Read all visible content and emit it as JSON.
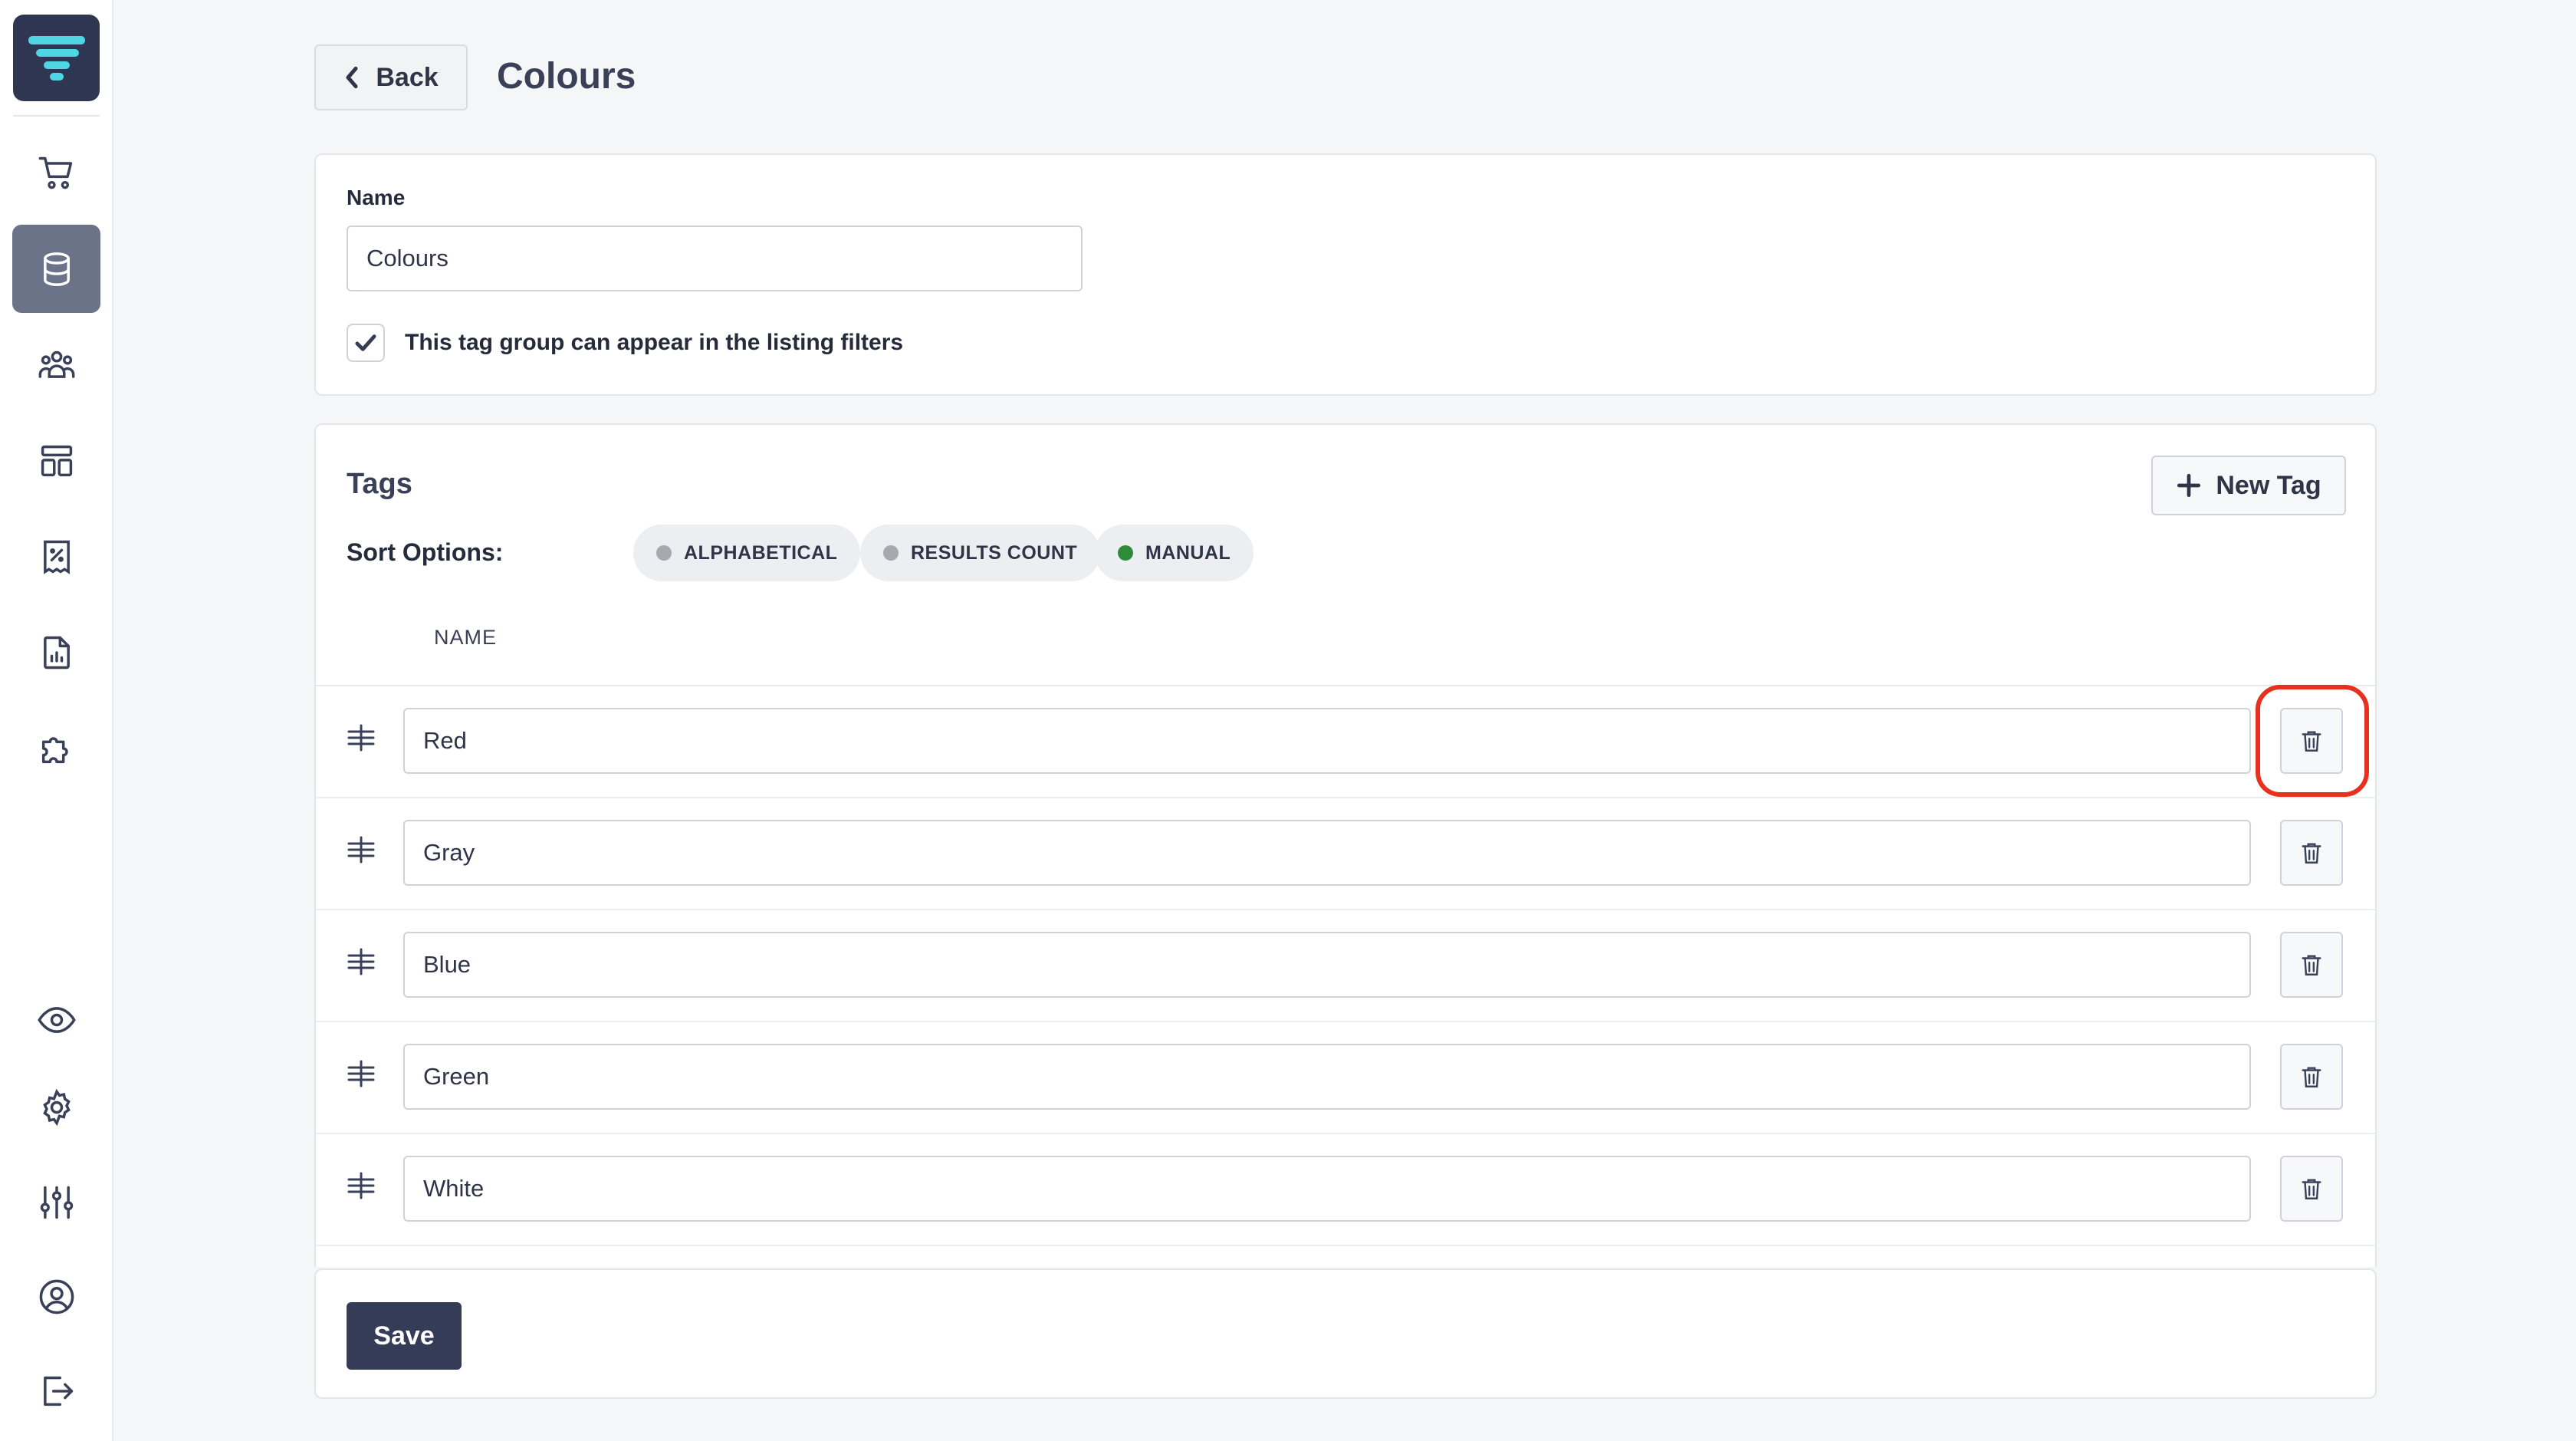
{
  "header": {
    "back_label": "Back",
    "title": "Colours"
  },
  "sidebar": {
    "items": [
      {
        "icon": "cart-icon"
      },
      {
        "icon": "database-icon",
        "active": true
      },
      {
        "icon": "users-icon"
      },
      {
        "icon": "layout-icon"
      },
      {
        "icon": "receipt-discount-icon"
      },
      {
        "icon": "report-icon"
      },
      {
        "icon": "puzzle-icon"
      },
      {
        "icon": "eye-icon"
      },
      {
        "icon": "gear-icon"
      },
      {
        "icon": "sliders-icon"
      },
      {
        "icon": "user-circle-icon"
      },
      {
        "icon": "logout-icon"
      }
    ]
  },
  "name_section": {
    "label": "Name",
    "value": "Colours",
    "checkbox_label": "This tag group can appear in the listing filters",
    "checkbox_checked": true
  },
  "tags_section": {
    "title": "Tags",
    "new_tag_label": "New Tag",
    "sort_label": "Sort Options:",
    "sort_options": [
      {
        "label": "ALPHABETICAL",
        "dot_color": "#a6a9b0"
      },
      {
        "label": "RESULTS COUNT",
        "dot_color": "#a6a9b0"
      },
      {
        "label": "MANUAL",
        "dot_color": "#2e8b3a"
      }
    ],
    "column_header": "NAME",
    "tags": [
      "Red",
      "Gray",
      "Blue",
      "Green",
      "White"
    ]
  },
  "footer": {
    "save_label": "Save"
  },
  "colors": {
    "primary_dark": "#353c57",
    "highlight": "#e8301e",
    "active_sidebar": "#6a7387"
  }
}
